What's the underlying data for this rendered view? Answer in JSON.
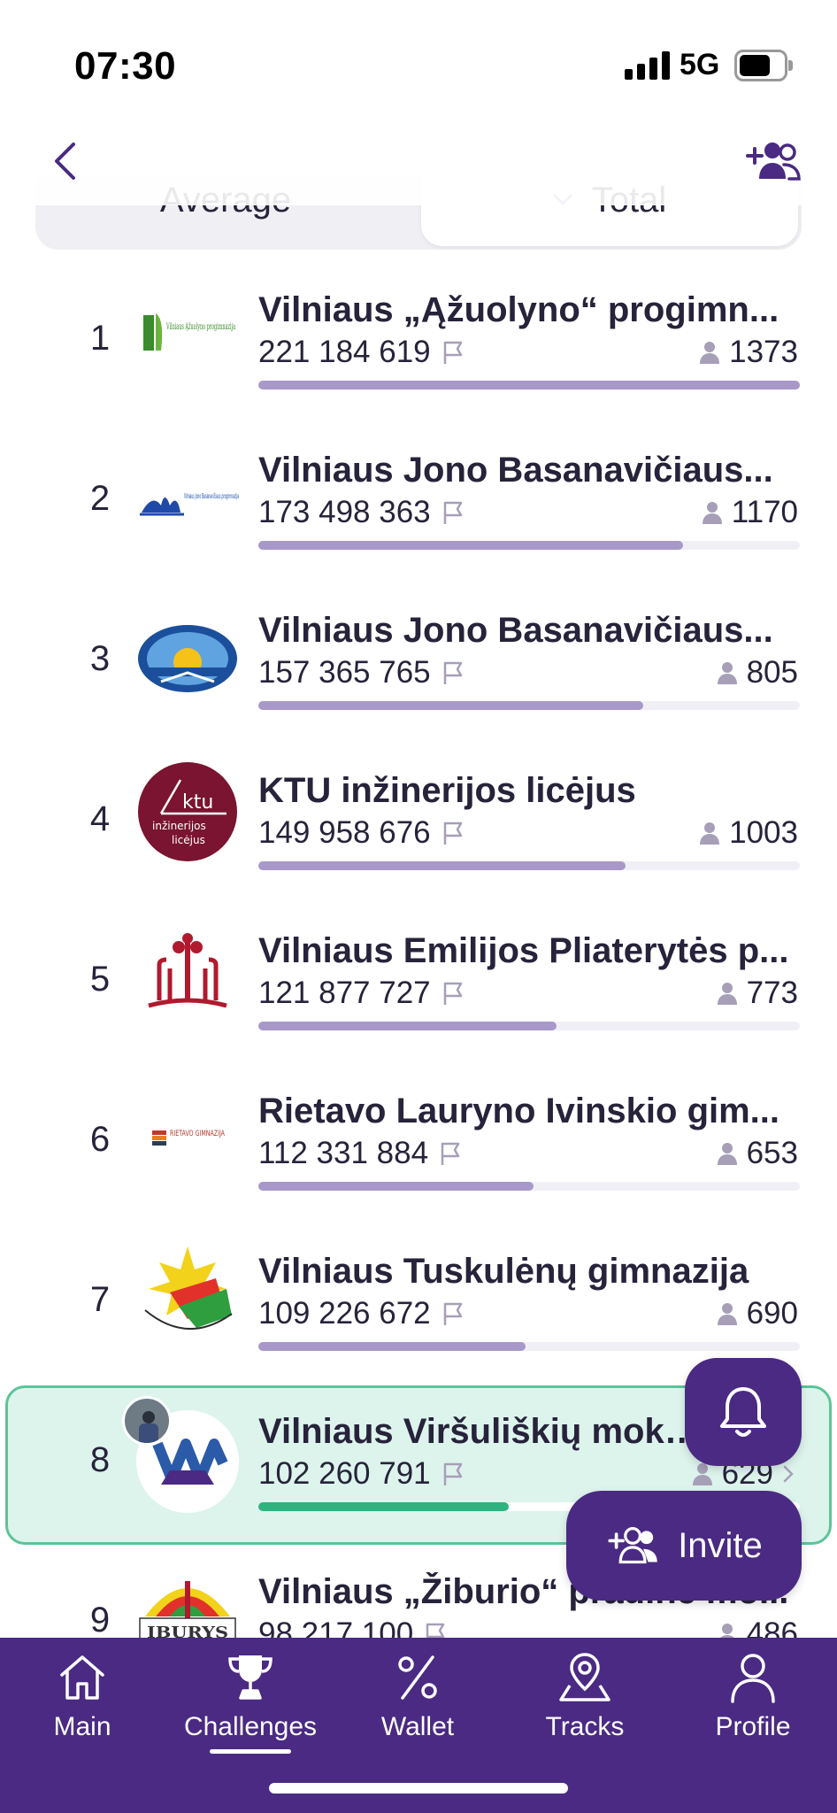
{
  "status_bar": {
    "time": "07:30",
    "network": "5G"
  },
  "header": {
    "back_icon": "chevron-left-icon",
    "add_friends_icon": "add-people-icon"
  },
  "segment": {
    "left_label": "Average",
    "right_label": "Total",
    "selected": "Total"
  },
  "colors": {
    "primary": "#4a2a82",
    "bar": "#a898c9",
    "highlight_bg": "#ddf4ec",
    "highlight_border": "#5bc49a",
    "highlight_bar": "#2fb37f"
  },
  "leaderboard": [
    {
      "rank": "1",
      "name": "Vilniaus „Ąžuolyno“ progimn...",
      "score": "221 184 619",
      "members": "1373",
      "progress": 1.0
    },
    {
      "rank": "2",
      "name": "Vilniaus Jono Basanavičiaus...",
      "score": "173 498 363",
      "members": "1170",
      "progress": 0.785
    },
    {
      "rank": "3",
      "name": "Vilniaus Jono Basanavičiaus...",
      "score": "157 365 765",
      "members": "805",
      "progress": 0.711
    },
    {
      "rank": "4",
      "name": "KTU inžinerijos licėjus",
      "score": "149 958 676",
      "members": "1003",
      "progress": 0.678
    },
    {
      "rank": "5",
      "name": "Vilniaus Emilijos Pliaterytės p...",
      "score": "121 877 727",
      "members": "773",
      "progress": 0.551
    },
    {
      "rank": "6",
      "name": "Rietavo Lauryno Ivinskio gim...",
      "score": "112 331 884",
      "members": "653",
      "progress": 0.508
    },
    {
      "rank": "7",
      "name": "Vilniaus Tuskulėnų gimnazija",
      "score": "109 226 672",
      "members": "690",
      "progress": 0.494
    },
    {
      "rank": "8",
      "name": "Vilniaus Viršuliškių mokykla",
      "score": "102 260 791",
      "members": "629",
      "progress": 0.462,
      "mine": true
    },
    {
      "rank": "9",
      "name": "Vilniaus „Žiburio“ pradinė mo...",
      "score": "98 217 100",
      "members": "486",
      "progress": 0.444
    }
  ],
  "logos": {
    "school_1_logo_text": "Vilniaus Ąžuolyno progimnazija",
    "school_2_logo_text": "Vilniaus Jono Basanavičiaus progimnazija",
    "school_4_logo_text": "ktu inžinerijos licėjus",
    "school_6_logo_text": "RIETAVO GIMNAZIJA",
    "school_9_logo_text": "IBURYS"
  },
  "fab": {
    "bell_icon": "bell-icon",
    "invite_label": "Invite"
  },
  "tabs": [
    {
      "label": "Main",
      "icon": "home-icon"
    },
    {
      "label": "Challenges",
      "icon": "trophy-icon",
      "active": true
    },
    {
      "label": "Wallet",
      "icon": "percent-icon"
    },
    {
      "label": "Tracks",
      "icon": "map-pin-icon"
    },
    {
      "label": "Profile",
      "icon": "user-icon"
    }
  ]
}
